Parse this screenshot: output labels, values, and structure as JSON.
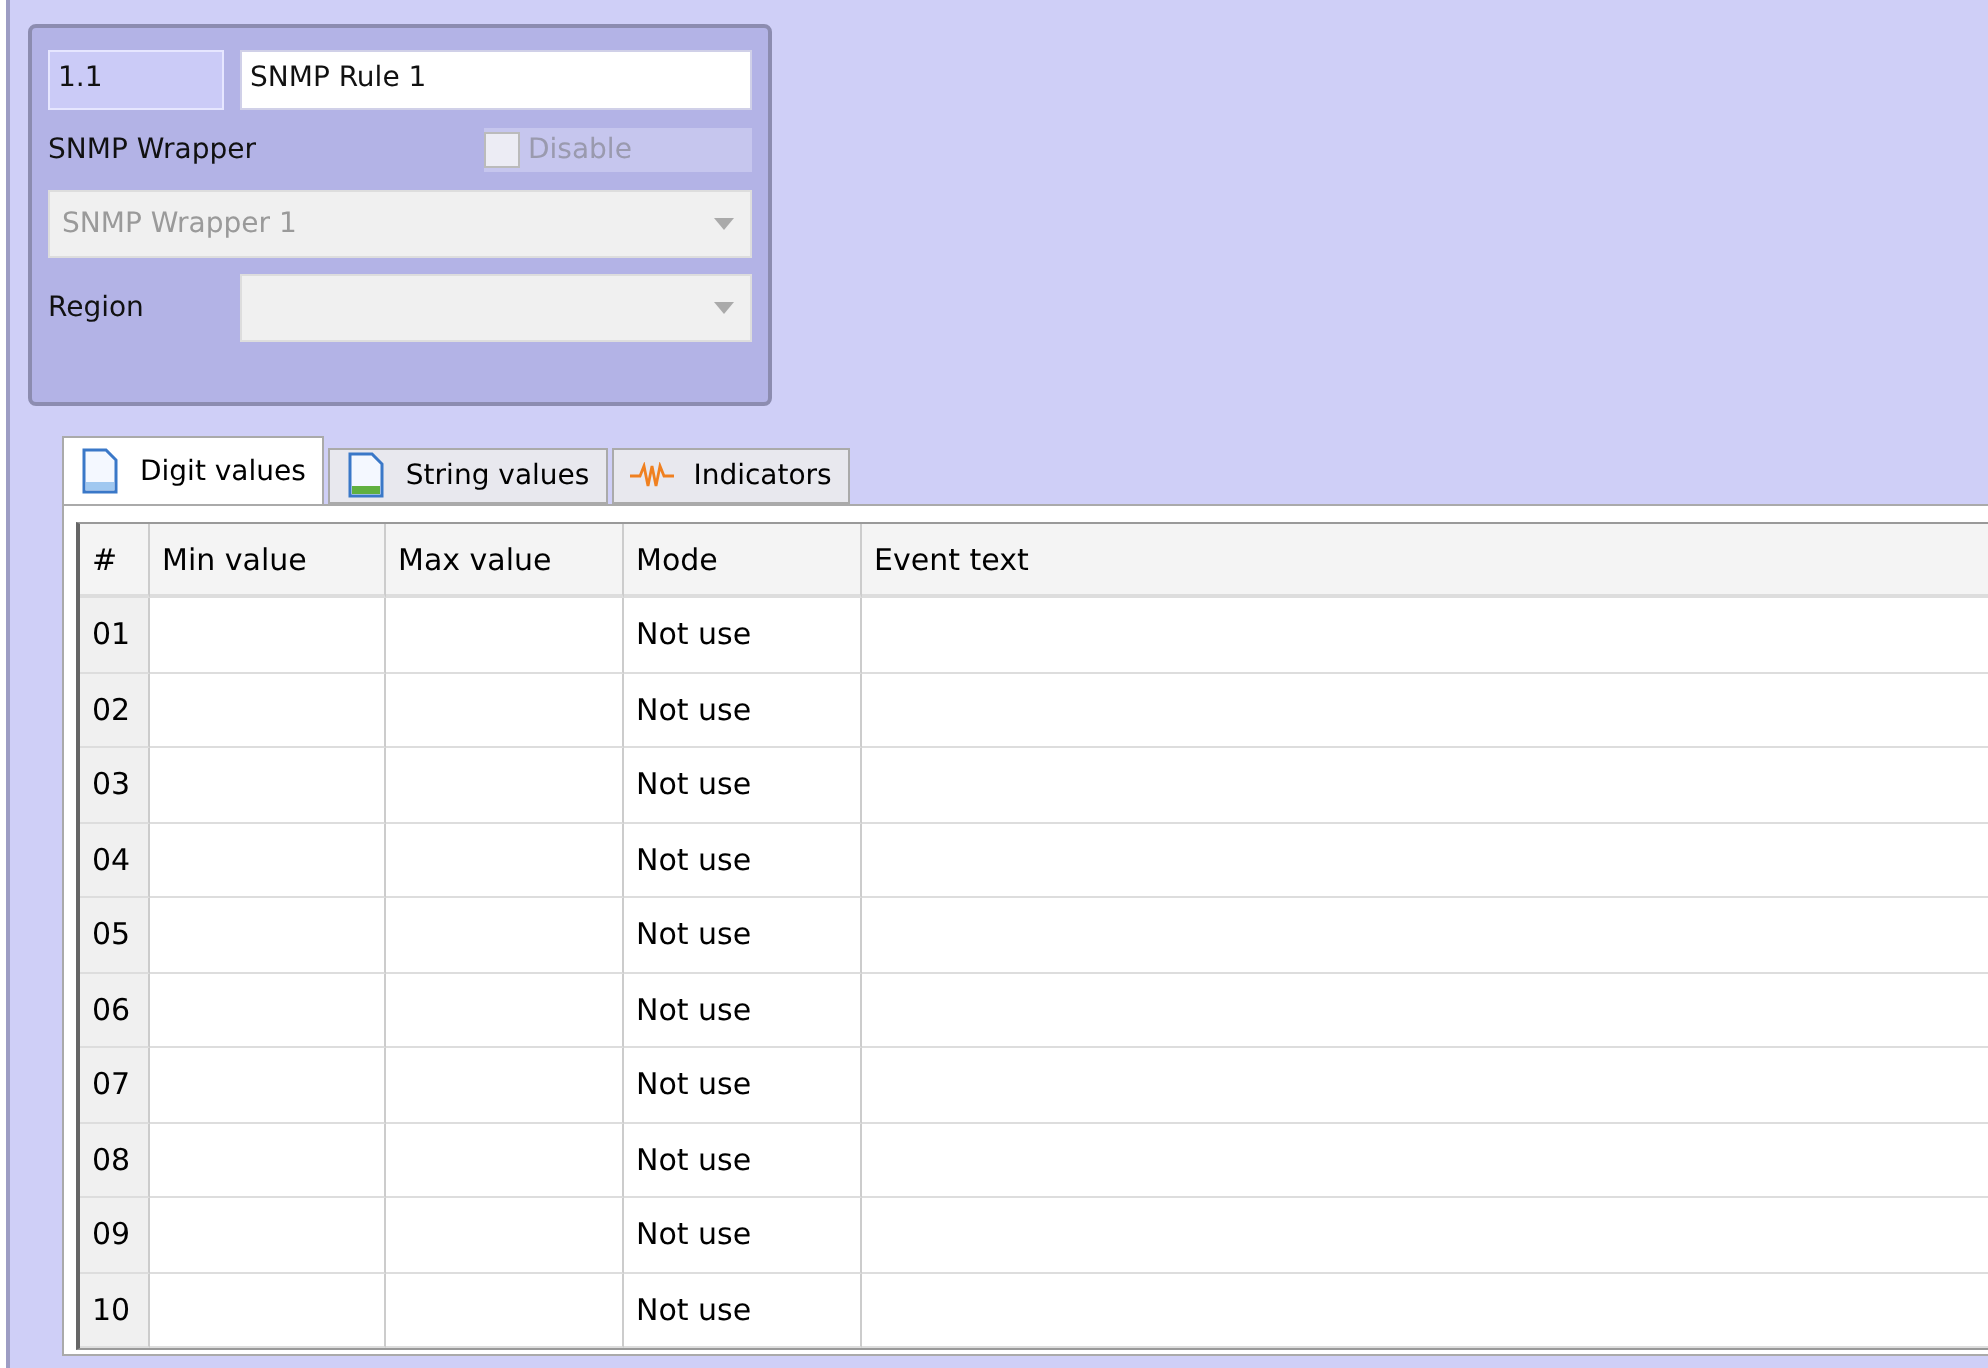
{
  "rule": {
    "number": "1.1",
    "name": "SNMP Rule 1"
  },
  "wrapper": {
    "label": "SNMP Wrapper",
    "disable": {
      "label": "Disable",
      "checked": false,
      "disabled": true
    },
    "value": "SNMP Wrapper 1",
    "disabled": true
  },
  "region": {
    "label": "Region",
    "disabled": true
  },
  "tabs": [
    {
      "label": "Digit values",
      "kind": "digits",
      "selected": true
    },
    {
      "label": "String values",
      "kind": "strings",
      "selected": false
    },
    {
      "label": "Indicators",
      "kind": "indicators",
      "selected": false
    }
  ],
  "table": {
    "columns": [
      "#",
      "Min value",
      "Max value",
      "Mode",
      "Event text"
    ],
    "rows": [
      [
        "01",
        "",
        "",
        "Not use",
        ""
      ],
      [
        "02",
        "",
        "",
        "Not use",
        ""
      ],
      [
        "03",
        "",
        "",
        "Not use",
        ""
      ],
      [
        "04",
        "",
        "",
        "Not use",
        ""
      ],
      [
        "05",
        "",
        "",
        "Not use",
        ""
      ],
      [
        "06",
        "",
        "",
        "Not use",
        ""
      ],
      [
        "07",
        "",
        "",
        "Not use",
        ""
      ],
      [
        "08",
        "",
        "",
        "Not use",
        ""
      ],
      [
        "09",
        "",
        "",
        "Not use",
        ""
      ],
      [
        "10",
        "",
        "",
        "Not use",
        ""
      ]
    ]
  }
}
